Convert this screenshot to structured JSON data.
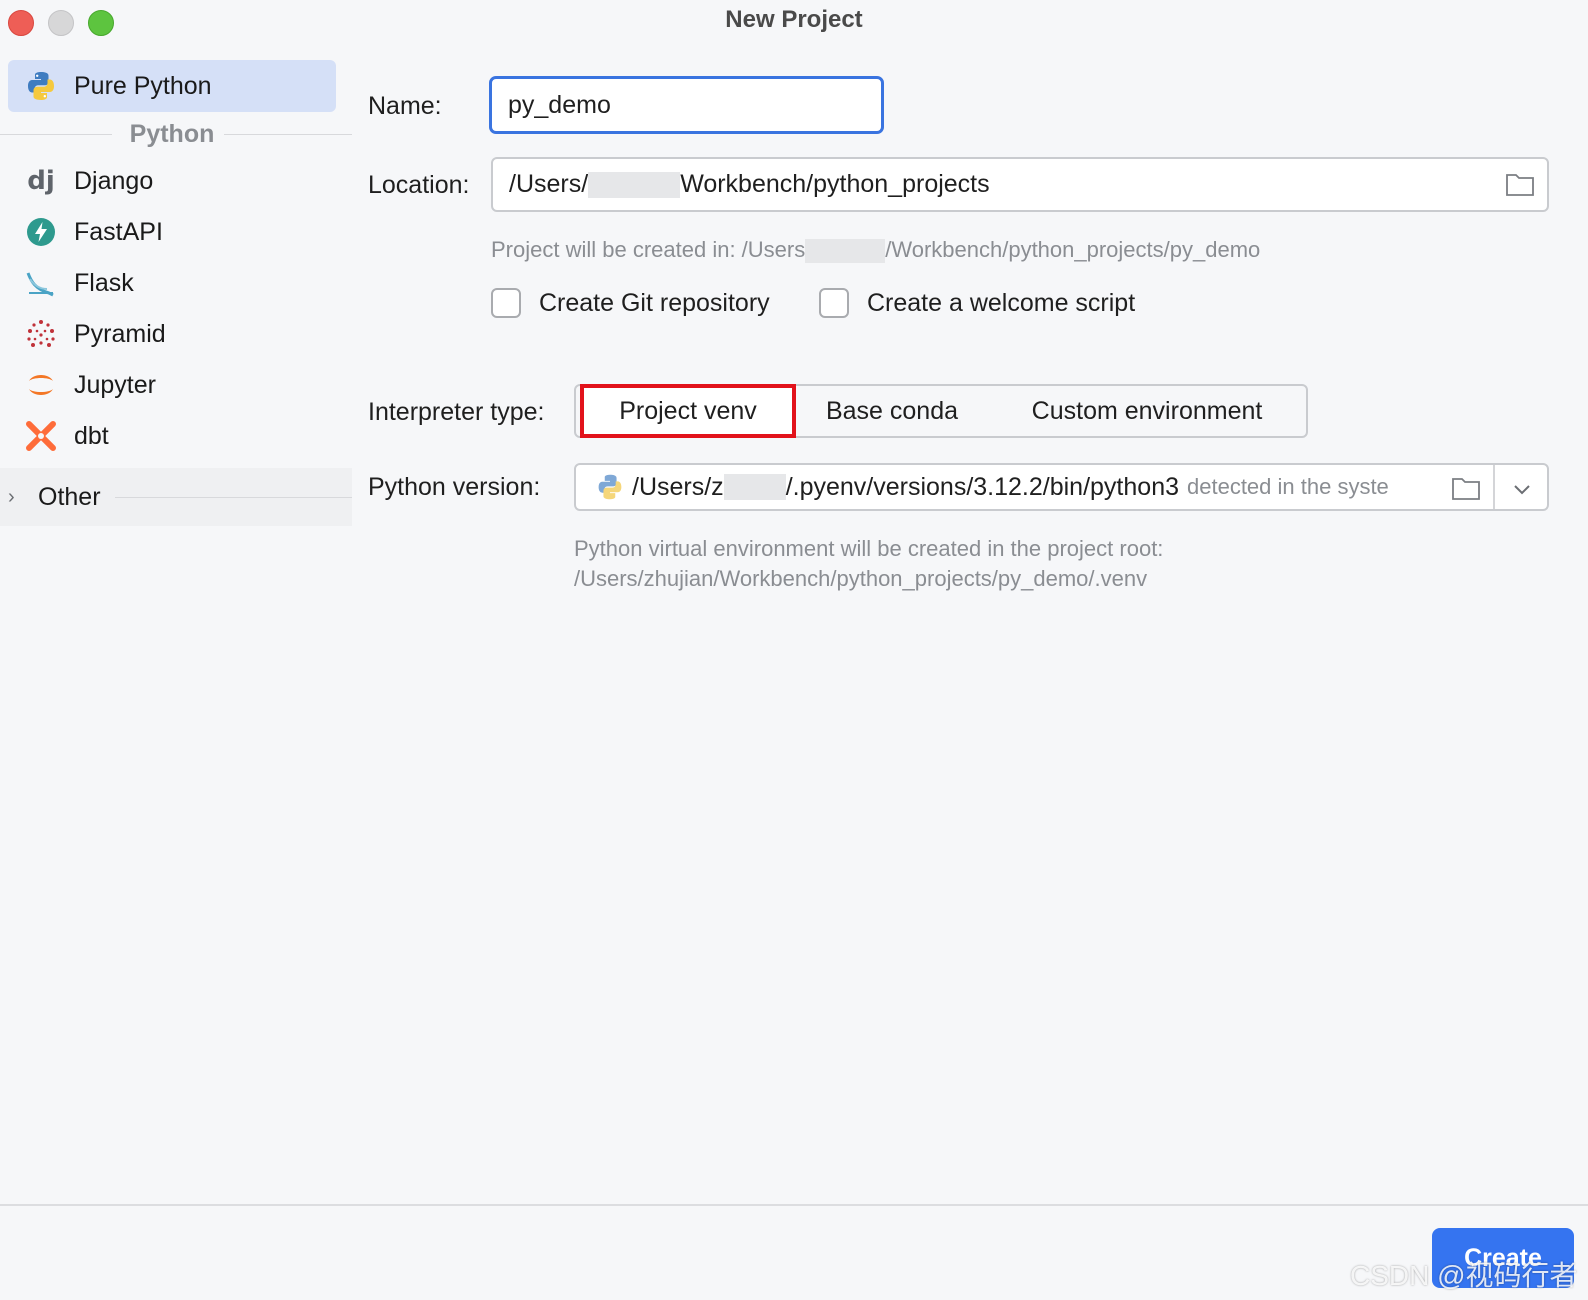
{
  "window": {
    "title": "New Project"
  },
  "sidebar": {
    "selected": {
      "label": "Pure Python"
    },
    "group_label": "Python",
    "items": [
      {
        "label": "Django",
        "icon": "django-icon"
      },
      {
        "label": "FastAPI",
        "icon": "fastapi-icon"
      },
      {
        "label": "Flask",
        "icon": "flask-icon"
      },
      {
        "label": "Pyramid",
        "icon": "pyramid-icon"
      },
      {
        "label": "Jupyter",
        "icon": "jupyter-icon"
      },
      {
        "label": "dbt",
        "icon": "dbt-icon"
      }
    ],
    "other_label": "Other"
  },
  "form": {
    "name_label": "Name:",
    "name_value": "py_demo",
    "location_label": "Location:",
    "location_prefix": "/Users/",
    "location_suffix": "Workbench/python_projects",
    "created_in_prefix": "Project will be created in: /Users",
    "created_in_suffix": "/Workbench/python_projects/py_demo",
    "git_label": "Create Git repository",
    "welcome_label": "Create a welcome script",
    "interpreter_label": "Interpreter type:",
    "interpreter_options": [
      "Project venv",
      "Base conda",
      "Custom environment"
    ],
    "python_version_label": "Python version:",
    "python_path_prefix": "/Users/z",
    "python_path_suffix": "/.pyenv/versions/3.12.2/bin/python3",
    "python_detected": "detected in the syste",
    "venv_hint_line1": "Python virtual environment will be created in the project root:",
    "venv_hint_line2": "/Users/zhujian/Workbench/python_projects/py_demo/.venv"
  },
  "footer": {
    "create_label": "Create",
    "watermark": "CSDN @视码行者"
  },
  "colors": {
    "accent": "#3574f0",
    "highlight": "#e2121b",
    "selected_bg": "#d5e0f7"
  }
}
